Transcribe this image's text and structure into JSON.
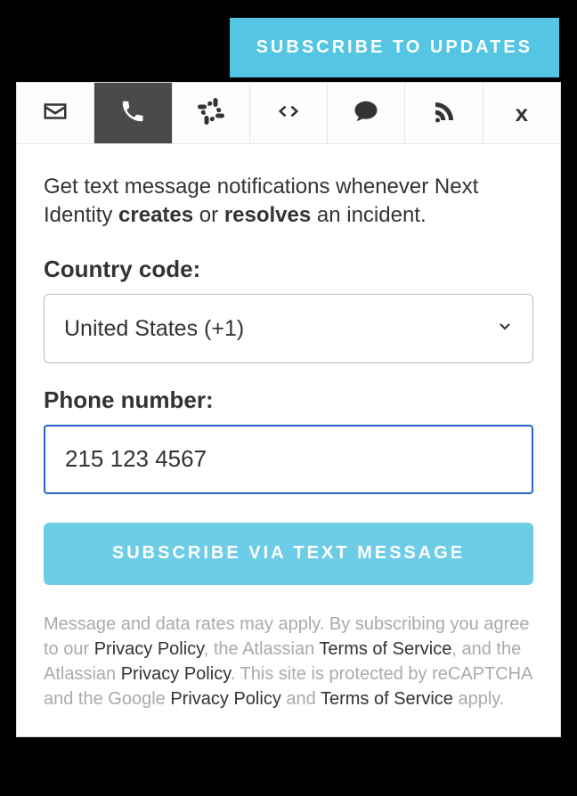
{
  "header": {
    "subscribe_button": "SUBSCRIBE TO UPDATES"
  },
  "intro": {
    "prefix": "Get text message notifications whenever Next Identity ",
    "bold1": "creates",
    "mid": " or ",
    "bold2": "resolves",
    "suffix": " an incident."
  },
  "country": {
    "label": "Country code:",
    "selected": "United States (+1)"
  },
  "phone": {
    "label": "Phone number:",
    "value": "215 123 4567"
  },
  "submit": {
    "label": "SUBSCRIBE VIA TEXT MESSAGE"
  },
  "footer": {
    "t1": "Message and data rates may apply. By subscribing you agree to our ",
    "l1": "Privacy Policy",
    "t2": ", the Atlassian ",
    "l2": "Terms of Service",
    "t3": ", and the Atlassian ",
    "l3": "Privacy Policy",
    "t4": ". This site is protected by reCAPTCHA and the Google ",
    "l4": "Privacy Policy",
    "t5": " and ",
    "l5": "Terms of Service",
    "t6": " apply."
  }
}
